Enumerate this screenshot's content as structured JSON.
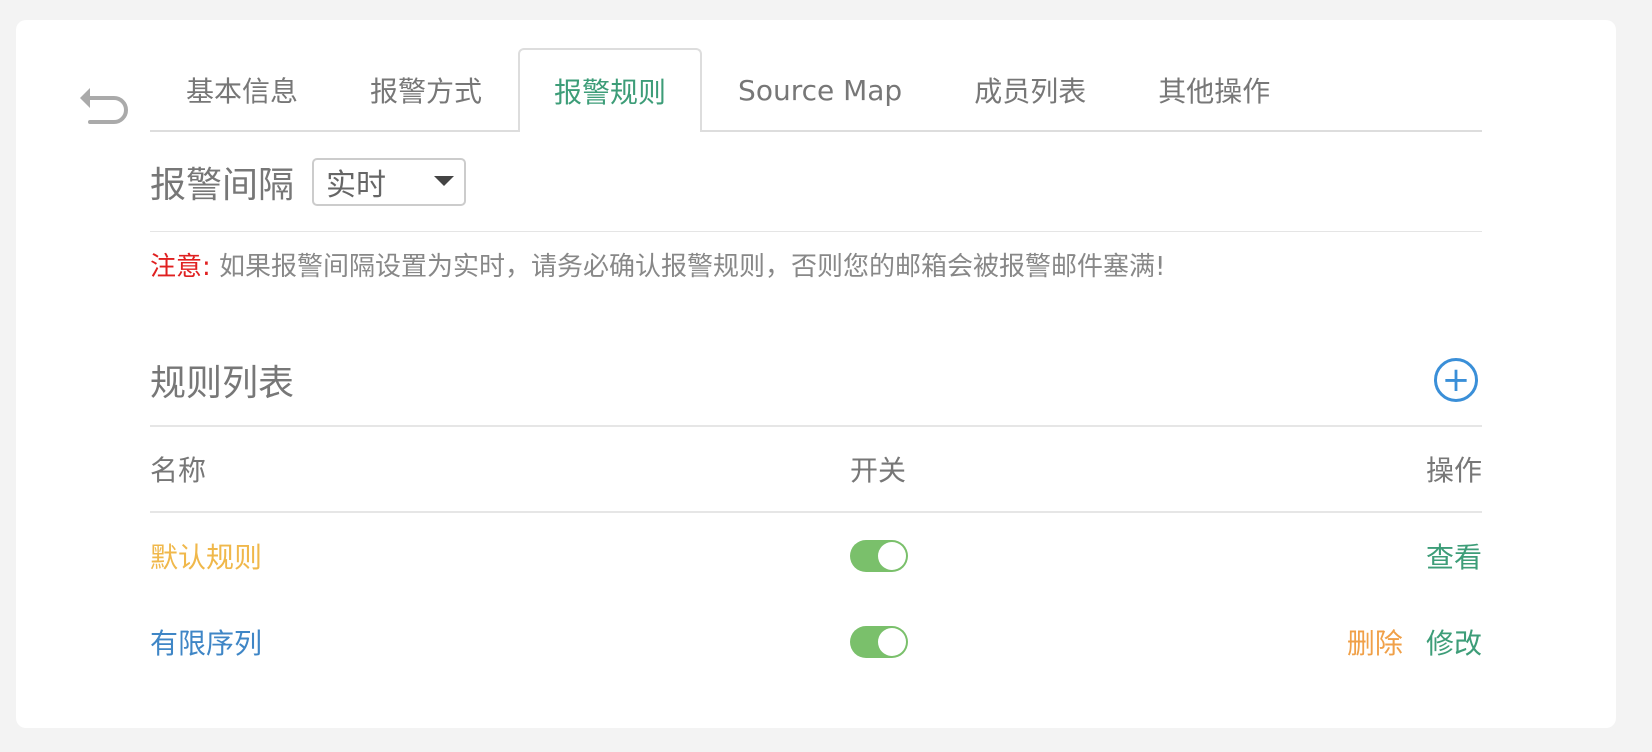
{
  "tabs": [
    {
      "label": "基本信息",
      "active": false
    },
    {
      "label": "报警方式",
      "active": false
    },
    {
      "label": "报警规则",
      "active": true
    },
    {
      "label": "Source Map",
      "active": false
    },
    {
      "label": "成员列表",
      "active": false
    },
    {
      "label": "其他操作",
      "active": false
    }
  ],
  "interval": {
    "label": "报警间隔",
    "selected": "实时"
  },
  "notice": {
    "prefix": "注意:",
    "text": " 如果报警间隔设置为实时，请务必确认报警规则，否则您的邮箱会被报警邮件塞满!"
  },
  "rules": {
    "title": "规则列表",
    "add_icon": "plus-circle-icon",
    "columns": {
      "name": "名称",
      "toggle": "开关",
      "actions": "操作"
    },
    "items": [
      {
        "name": "默认规则",
        "enabled": true,
        "actions": [
          "查看"
        ]
      },
      {
        "name": "有限序列",
        "enabled": true,
        "actions": [
          "删除",
          "修改"
        ]
      }
    ]
  },
  "colors": {
    "accent_green": "#3d9d78",
    "warning_red": "#e02020",
    "default_rule": "#f0b84b",
    "custom_rule": "#3f86c6",
    "add_blue": "#3a8fd8",
    "toggle_on": "#7ac06b",
    "delete_orange": "#f0a048"
  }
}
